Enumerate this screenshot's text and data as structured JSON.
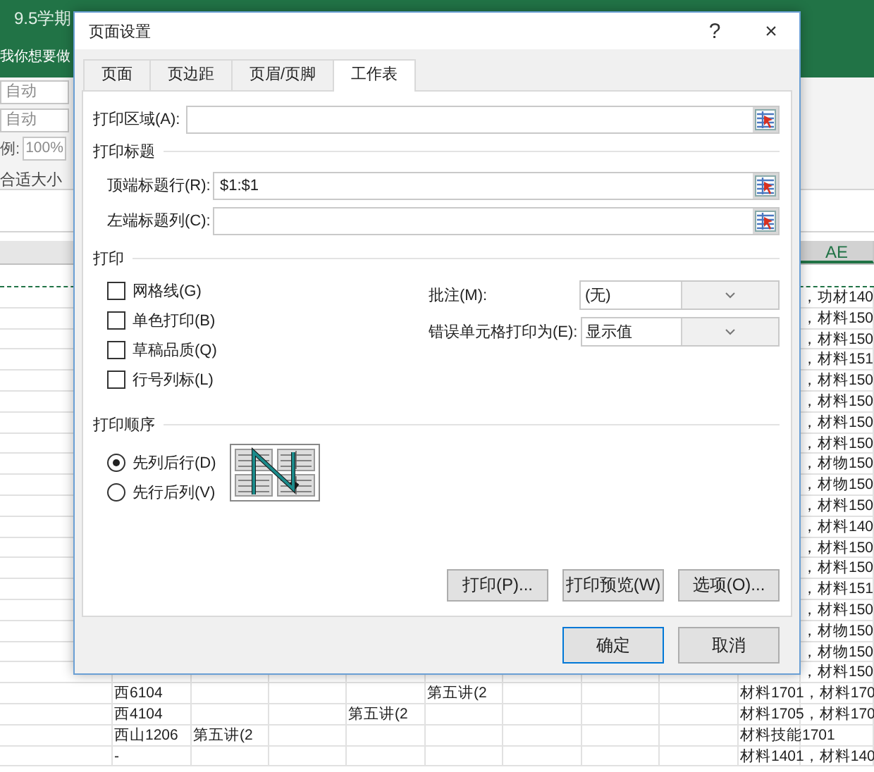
{
  "excel": {
    "title": "9.5学期",
    "tell_me": "我你想要做",
    "ribbon": {
      "width_field": "自动",
      "height_field": "自动",
      "scale_label": "例:",
      "scale_field": "100%",
      "fit_label": "合适大小"
    },
    "column_header": "AE",
    "rows": [
      {
        "column_10": "，功材140"
      },
      {
        "column_10": "，材料150"
      },
      {
        "column_10": "，材料150"
      },
      {
        "column_10": "，材料151"
      },
      {
        "column_10": "，材料150"
      },
      {
        "column_10": "，材料150"
      },
      {
        "column_10": "，材料150"
      },
      {
        "column_10": "，材料150"
      },
      {
        "column_10": "，材物150"
      },
      {
        "column_10": "，材物150"
      },
      {
        "column_10": "，材料150"
      },
      {
        "column_10": "，材料140"
      },
      {
        "column_10": "，材料150"
      },
      {
        "column_10": "，材料150"
      },
      {
        "column_10": "，材料151"
      },
      {
        "column_10": "，材料150"
      },
      {
        "column_10": "，材物150"
      },
      {
        "column_10": "，材物150"
      },
      {
        "column_10": "，材料150"
      },
      {
        "column_1": "西6104",
        "column_5": "第五讲(2",
        "column_9": "材料1701，材料170"
      },
      {
        "column_1": "西4104",
        "column_4": "第五讲(2",
        "column_9": "材料1705，材料170"
      },
      {
        "column_1": "西山1206",
        "column_2": "第五讲(2",
        "column_9": "材料技能1701"
      },
      {
        "column_1": "-",
        "column_9": "材料1401，材料140"
      }
    ]
  },
  "dialog": {
    "title": "页面设置",
    "help": "?",
    "close": "×",
    "tabs": [
      {
        "label": "页面",
        "selected": false
      },
      {
        "label": "页边距",
        "selected": false
      },
      {
        "label": "页眉/页脚",
        "selected": false
      },
      {
        "label": "工作表",
        "selected": true
      }
    ],
    "print_area": {
      "label": "打印区域(A):"
    },
    "titles_header": "打印标题",
    "title_fields": [
      {
        "label": "顶端标题行(R):",
        "value": "$1:$1"
      },
      {
        "label": "左端标题列(C):"
      }
    ],
    "print_header": "打印",
    "checkboxes": [
      {
        "label": "网格线(G)",
        "checked": false
      },
      {
        "label": "单色打印(B)",
        "checked": false
      },
      {
        "label": "草稿品质(Q)",
        "checked": false
      },
      {
        "label": "行号列标(L)",
        "checked": false
      }
    ],
    "selects": [
      {
        "label": "批注(M):",
        "value": "(无)"
      },
      {
        "label": "错误单元格打印为(E):",
        "value": "显示值"
      }
    ],
    "order_header": "打印顺序",
    "order_options": [
      {
        "label": "先列后行(D)",
        "selected": true
      },
      {
        "label": "先行后列(V)",
        "selected": false
      }
    ],
    "panel_buttons": [
      "打印(P)...",
      "打印预览(W)",
      "选项(O)..."
    ],
    "buttons": [
      {
        "label": "确定",
        "default": true
      },
      {
        "label": "取消",
        "default": false
      }
    ]
  }
}
